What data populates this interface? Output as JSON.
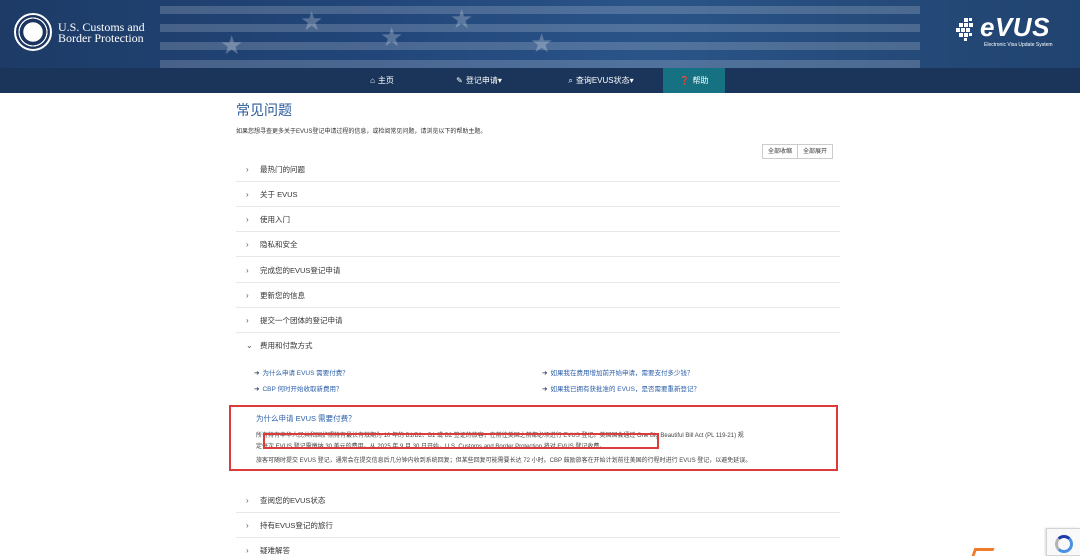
{
  "header": {
    "agency_line1": "U.S. Customs and",
    "agency_line2": "Border Protection",
    "logo_text": "eVUS",
    "logo_sub": "Electronic Visa Update System",
    "colors": {
      "header_bg": "#22467a",
      "nav_bg": "#1a3559",
      "nav_active": "#167283",
      "link": "#2a5ea8",
      "highlight_border": "#dc3b3b"
    }
  },
  "nav": {
    "items": [
      {
        "label": "主页",
        "icon": "home-icon"
      },
      {
        "label": "登记申请",
        "icon": "pencil-icon"
      },
      {
        "label": "查询EVUS状态",
        "icon": "search-icon"
      },
      {
        "label": "帮助",
        "icon": "help-icon"
      }
    ],
    "active": "帮助"
  },
  "main": {
    "title": "常见问题",
    "description": "如果您想寻查更多关于EVUS登记申请过程的信息，或检阅常见问题，请浏览以下的帮助主题。",
    "collapse_all": "全部收缩",
    "expand_all": "全部展开",
    "sections_top": [
      "最热门的问题",
      "关于 EVUS",
      "使用入门",
      "隐私和安全",
      "完成您的EVUS登记申请",
      "更新您的信息",
      "提交一个团体的登记申请",
      "费用和付款方式"
    ],
    "sub_links": [
      "为什么申请 EVUS 需要付费？",
      "CBP 何时开始收取新费用？",
      "如果我在费用增加前开始申请，需要支付多少钱？",
      "如果我已拥有获批准的 EVUS，是否需要重新登记？"
    ],
    "answer": {
      "title": "为什么申请 EVUS 需要付费？",
      "line1": "所有持有中华人民共和国护照持有最长有效期为 10 年的 B1/B2、B1 或 B2 签证的旅客，在前往美国之前都必须进行 EVUS 登记。美国国会通过 One Big Beautiful Bill Act (PL 119-21) 规",
      "line2": "定每次 EVUS 登记需缴纳 30 美元的费用。从 2025 年 9 月 30 日开始，U.S. Customs and Border Protection 将对 EVUS 登记收费。",
      "line3": "旅客可随时提交 EVUS 登记，通常会在提交信息后几分钟内收到系统回复；但某些回复可能需要长达 72 小时。CBP 鼓励旅客在开始计划前往美国的行程时进行 EVUS 登记，以避免延误。"
    },
    "sections_bottom": [
      "查阅您的EVUS状态",
      "持有EVUS登记的旅行",
      "疑难解答"
    ]
  }
}
